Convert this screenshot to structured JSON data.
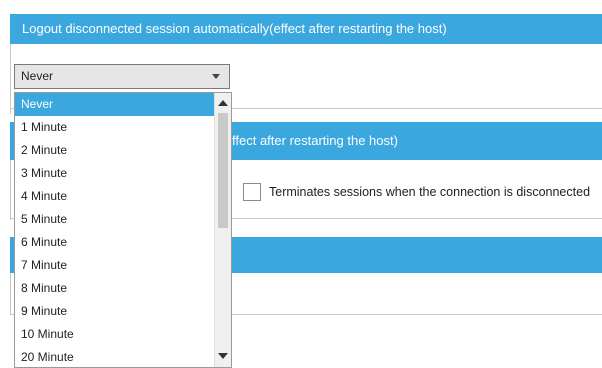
{
  "sections": {
    "logout": {
      "title": "Logout disconnected session automatically(effect after restarting the host)"
    },
    "second": {
      "title_partial": "ffect after restarting the host)"
    }
  },
  "select": {
    "value": "Never"
  },
  "dropdown": {
    "options": [
      "Never",
      "1 Minute",
      "2 Minute",
      "3 Minute",
      "4 Minute",
      "5 Minute",
      "6 Minute",
      "7 Minute",
      "8 Minute",
      "9 Minute",
      "10 Minute",
      "20 Minute"
    ],
    "selected": "Never"
  },
  "terminate": {
    "label": "Terminates sessions when the connection is disconnected",
    "checked": false
  },
  "colors": {
    "accent": "#3aa8df"
  }
}
